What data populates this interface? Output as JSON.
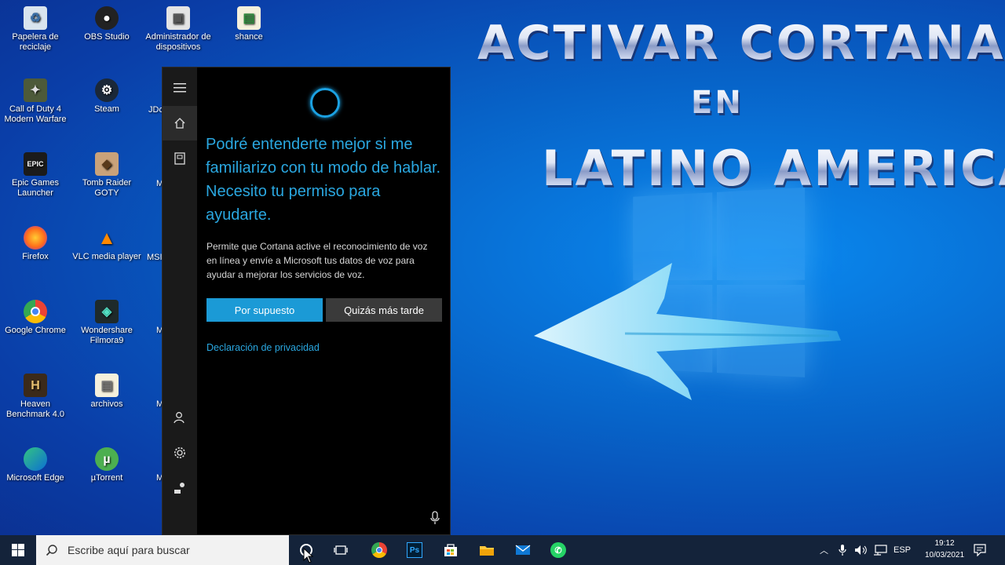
{
  "title": {
    "line1": "Activar Cortana",
    "line2": "en",
    "line3": "Latino America"
  },
  "desktop_icons": [
    {
      "label": "Papelera de reciclaje",
      "icon": "recycle-bin-icon"
    },
    {
      "label": "OBS Studio",
      "icon": "obs-icon"
    },
    {
      "label": "Administrador de dispositivos",
      "icon": "device-manager-icon"
    },
    {
      "label": "shance",
      "icon": "file-icon"
    },
    {
      "label": "Call of Duty 4 Modern Warfare",
      "icon": "game-icon"
    },
    {
      "label": "Steam",
      "icon": "steam-icon"
    },
    {
      "label": "Epic Games Launcher",
      "icon": "epic-icon"
    },
    {
      "label": "Tomb Raider GOTY",
      "icon": "game-icon"
    },
    {
      "label": "Firefox",
      "icon": "firefox-icon"
    },
    {
      "label": "VLC media player",
      "icon": "vlc-icon"
    },
    {
      "label": "Google Chrome",
      "icon": "chrome-icon"
    },
    {
      "label": "Wondershare Filmora9",
      "icon": "filmora-icon"
    },
    {
      "label": "Heaven Benchmark 4.0",
      "icon": "heaven-icon"
    },
    {
      "label": "archivos",
      "icon": "file-icon"
    },
    {
      "label": "Microsoft Edge",
      "icon": "edge-icon"
    },
    {
      "label": "µTorrent",
      "icon": "utorrent-icon"
    }
  ],
  "partial_labels": [
    "JDo",
    "M",
    "MSI",
    "M",
    "M",
    "M"
  ],
  "cortana": {
    "headline": "Podré entenderte mejor si me familiarizo con tu modo de hablar. Necesito tu permiso para ayudarte.",
    "body": "Permite que Cortana active el reconocimiento de voz en línea y envíe a Microsoft tus datos de voz para ayudar a mejorar los servicios de voz.",
    "accept_label": "Por supuesto",
    "later_label": "Quizás más tarde",
    "privacy_label": "Declaración de privacidad",
    "accent": "#1b9ad6"
  },
  "taskbar": {
    "search_placeholder": "Escribe aquí para buscar",
    "language": "ESP",
    "time": "19:12",
    "date": "10/03/2021",
    "ps_label": "Ps"
  }
}
